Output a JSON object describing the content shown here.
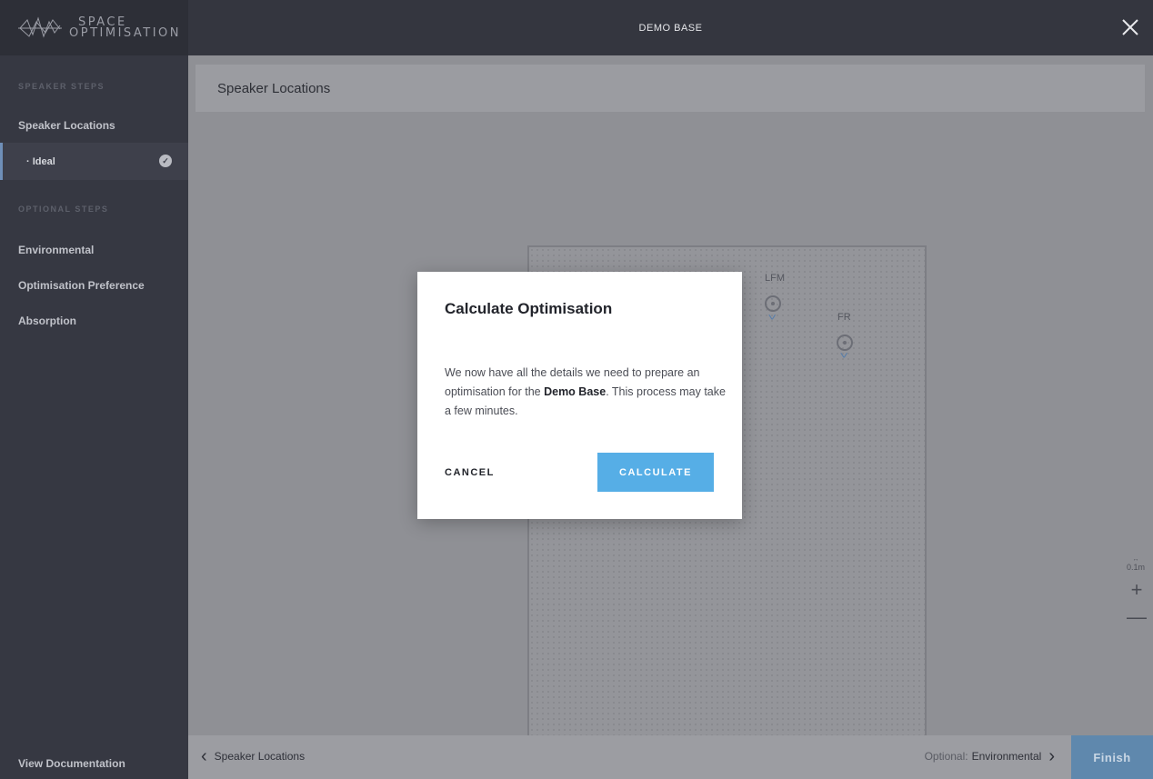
{
  "app": {
    "logo_line1": "SPACE",
    "logo_line2": "OPTIMISATION",
    "title": "DEMO BASE"
  },
  "sidebar": {
    "section1": "SPEAKER STEPS",
    "item1": "Speaker Locations",
    "sub_item": "· Ideal",
    "section2": "OPTIONAL STEPS",
    "items": [
      "Environmental",
      "Optimisation Preference",
      "Absorption"
    ],
    "footer": "View Documentation"
  },
  "main": {
    "section_title": "Speaker Locations",
    "speakers": [
      "LFM",
      "FR"
    ],
    "scale_label": "0.1m",
    "zoom_in": "+",
    "zoom_out": "—"
  },
  "bottom": {
    "back_label": "Speaker Locations",
    "next_prefix": "Optional:",
    "next_label": "Environmental",
    "finish_label": "Finish"
  },
  "modal": {
    "title": "Calculate Optimisation",
    "body_pre": "We now have all the details we need to prepare an optimisation for the ",
    "body_bold": "Demo Base",
    "body_post": ". This process may take a few minutes.",
    "cancel": "CANCEL",
    "calculate": "CALCULATE"
  }
}
